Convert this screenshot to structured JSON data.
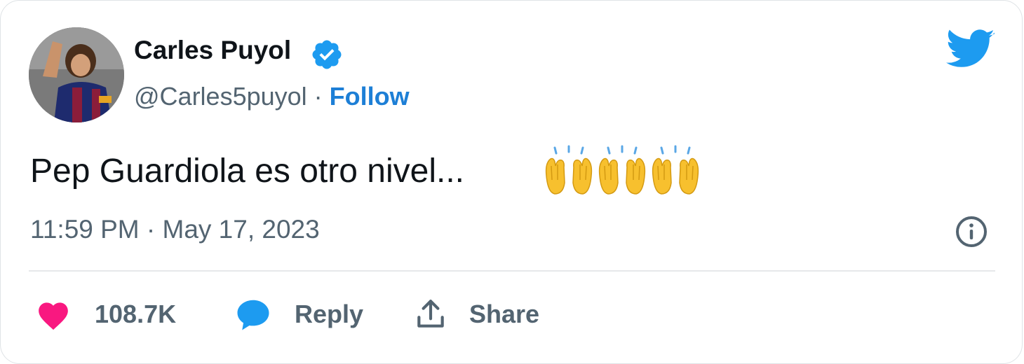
{
  "author": {
    "name": "Carles Puyol",
    "handle": "@Carles5puyol",
    "separator": "·",
    "follow_label": "Follow",
    "verified": true
  },
  "tweet": {
    "text": "Pep Guardiola es otro nivel...",
    "emoji": "raising-hands-emoji",
    "emoji_count": 3,
    "timestamp": "11:59 PM · May 17, 2023"
  },
  "actions": {
    "like_count": "108.7K",
    "reply_label": "Reply",
    "share_label": "Share"
  },
  "icons": {
    "brand": "twitter-bird-icon",
    "info": "info-icon",
    "like": "heart-icon",
    "reply": "speech-bubble-icon",
    "share": "share-icon"
  },
  "colors": {
    "twitter_blue": "#1d9bf0",
    "follow_blue": "#1d7fd6",
    "heart_pink": "#f91880",
    "secondary_text": "#536471",
    "primary_text": "#0f1419"
  }
}
